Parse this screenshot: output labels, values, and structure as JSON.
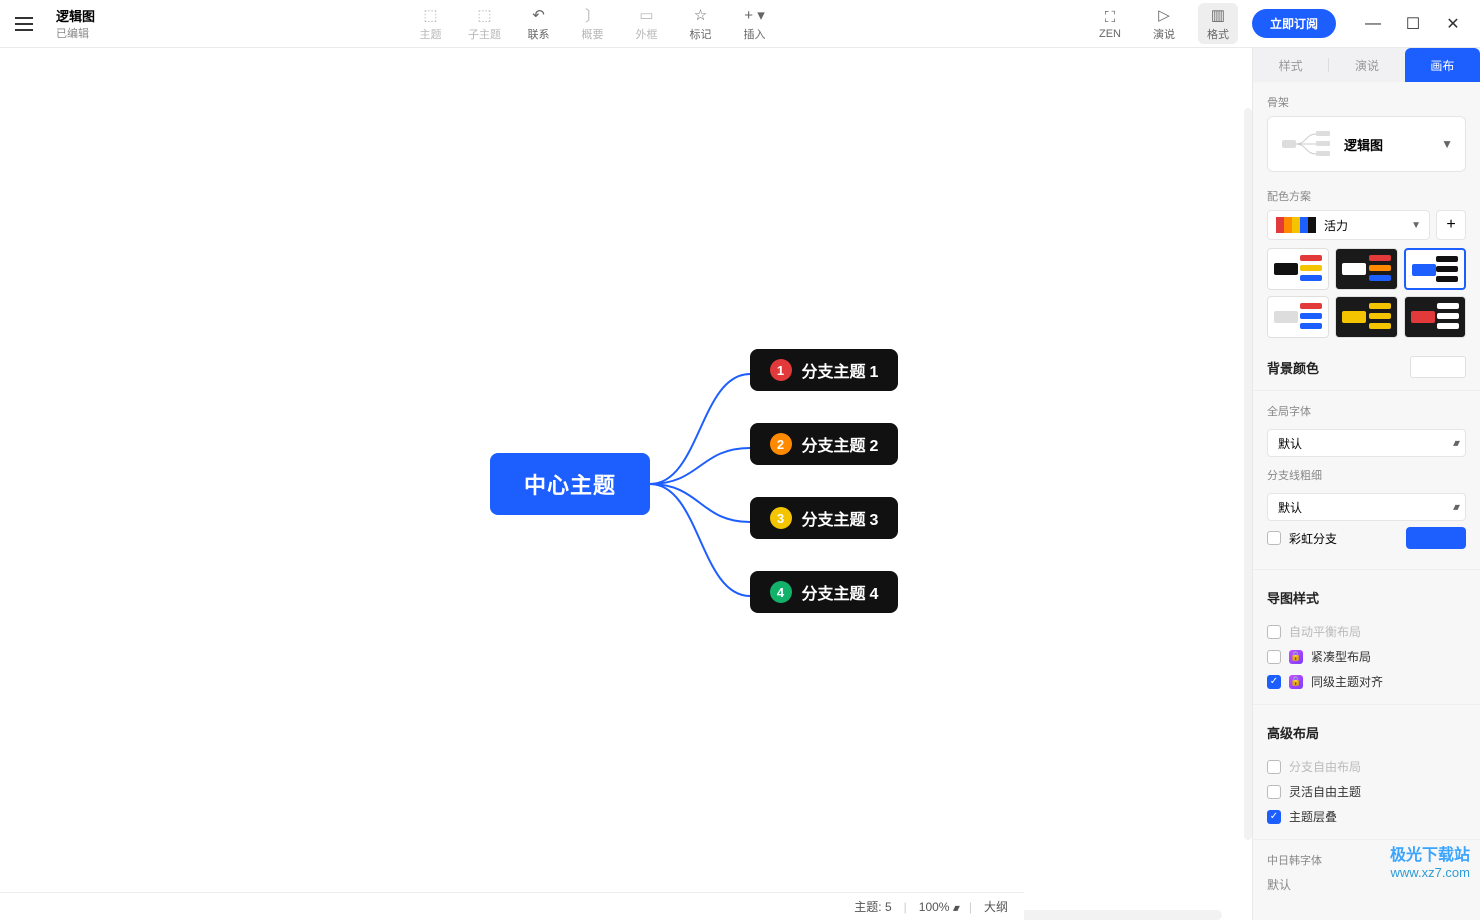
{
  "file": {
    "title": "逻辑图",
    "status": "已编辑"
  },
  "toolbar": {
    "items": [
      {
        "key": "topic",
        "label": "主题"
      },
      {
        "key": "subtopic",
        "label": "子主题"
      },
      {
        "key": "relation",
        "label": "联系"
      },
      {
        "key": "summary",
        "label": "概要"
      },
      {
        "key": "boundary",
        "label": "外框"
      },
      {
        "key": "marker",
        "label": "标记"
      },
      {
        "key": "insert",
        "label": "插入"
      }
    ],
    "right": [
      {
        "key": "zen",
        "label": "ZEN"
      },
      {
        "key": "pitch",
        "label": "演说"
      },
      {
        "key": "format",
        "label": "格式"
      }
    ],
    "subscribe": "立即订阅"
  },
  "mindmap": {
    "central": "中心主题",
    "branches": [
      {
        "num": "1",
        "label": "分支主题",
        "suffix": "1",
        "color": "#e23a3a"
      },
      {
        "num": "2",
        "label": "分支主题",
        "suffix": "2",
        "color": "#ff8a00"
      },
      {
        "num": "3",
        "label": "分支主题",
        "suffix": "3",
        "color": "#f5c400"
      },
      {
        "num": "4",
        "label": "分支主题",
        "suffix": "4",
        "color": "#13b26b"
      }
    ]
  },
  "panel": {
    "tabs": {
      "style": "样式",
      "pitch": "演说",
      "canvas": "画布"
    },
    "skeleton": {
      "label": "骨架",
      "value": "逻辑图"
    },
    "scheme": {
      "label": "配色方案",
      "value": "活力",
      "swatches": [
        "#e23a3a",
        "#ff8a00",
        "#f5c400",
        "#1d5eff",
        "#111111"
      ]
    },
    "background": {
      "label": "背景颜色"
    },
    "globalFont": {
      "label": "全局字体",
      "value": "默认"
    },
    "branchWeight": {
      "label": "分支线粗细",
      "value": "默认"
    },
    "rainbow": {
      "label": "彩虹分支"
    },
    "mapStyle": {
      "title": "导图样式",
      "autoBalance": "自动平衡布局",
      "compact": "紧凑型布局",
      "alignSiblings": "同级主题对齐"
    },
    "advanced": {
      "title": "高级布局",
      "freeBranch": "分支自由布局",
      "freeTopic": "灵活自由主题",
      "overlap": "主题层叠"
    },
    "cjkFont": {
      "label": "中日韩字体",
      "value": "默认"
    }
  },
  "status": {
    "topics_label": "主题:",
    "topics": "5",
    "zoom": "100%",
    "outline": "大纲"
  },
  "watermark": {
    "line1": "极光下载站",
    "line2": "www.xz7.com"
  },
  "icons": {
    "topic": "⬚",
    "subtopic": "⬚",
    "relation": "↶",
    "summary": "〕",
    "boundary": "▭",
    "marker": "☆",
    "insert": "+",
    "zen": "⛶",
    "pitch": "▷",
    "format": "▥"
  }
}
